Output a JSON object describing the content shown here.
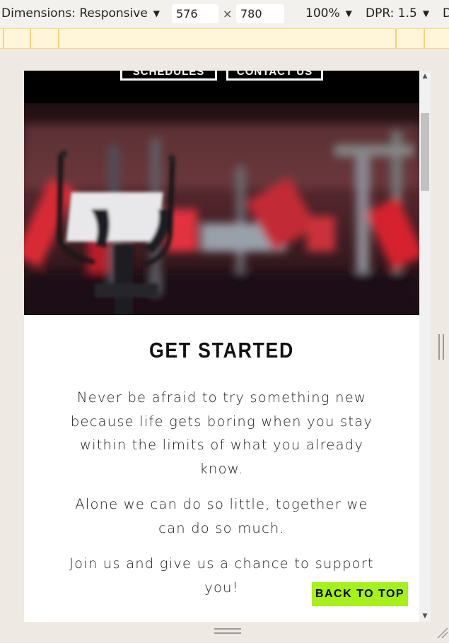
{
  "devtools": {
    "dimensions_label": "Dimensions: Responsive",
    "width": "576",
    "height": "780",
    "times": "×",
    "zoom": "100%",
    "dpr": "DPR: 1.5",
    "more": "D"
  },
  "page": {
    "nav": {
      "schedules": "SCHEDULES",
      "contact": "CONTACT US"
    },
    "hero_image": "gym-elliptical-photo",
    "heading": "GET STARTED",
    "paragraphs": [
      "Never be afraid to try something new because life gets boring when you stay within the limits of what you already know.",
      "Alone we can do so little, together we can do so much.",
      "Join us and give us a chance to support you!"
    ],
    "back_to_top": "BACK TO TOP"
  },
  "colors": {
    "accent": "#a7f019",
    "nav_bg": "#000000",
    "media_query_bar": "#fff6da"
  }
}
